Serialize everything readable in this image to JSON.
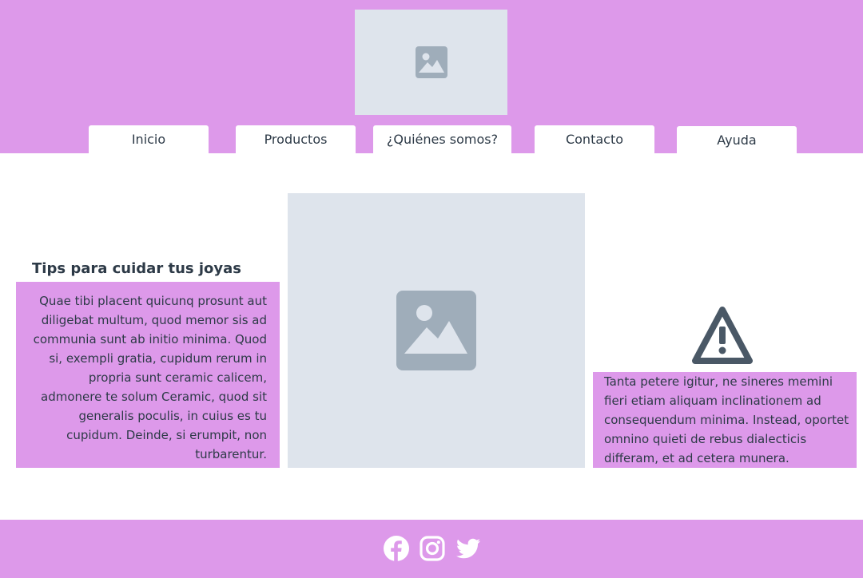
{
  "header": {
    "logo_icon": "image-placeholder-icon",
    "nav": [
      {
        "label": "Inicio"
      },
      {
        "label": "Productos"
      },
      {
        "label": "¿Quiénes somos?"
      },
      {
        "label": "Contacto"
      },
      {
        "label": "Ayuda"
      }
    ]
  },
  "main": {
    "tips_title": "Tips para cuidar tus joyas",
    "tips_text": "Quae tibi placent quicunq prosunt aut diligebat multum, quod memor sis ad communia sunt ab initio minima. Quod si, exempli gratia, cupidum rerum in propria sunt ceramic calicem, admonere te solum Ceramic, quod sit generalis poculis, in cuius es tu cupidum. Deinde, si erumpit, non turbarentur.",
    "hero_icon": "image-placeholder-icon",
    "warning_icon": "warning-icon",
    "side_text": "Tanta petere igitur, ne sineres memini fieri etiam aliquam inclinationem ad consequendum minima. Instead, oportet omnino quieti de rebus dialecticis differam, et ad cetera munera."
  },
  "footer": {
    "social_icons": [
      "facebook-icon",
      "instagram-icon",
      "twitter-icon"
    ]
  },
  "colors": {
    "accent": "#dd99ea",
    "placeholder_bg": "#dee4ec",
    "placeholder_icon": "#9fadba",
    "text": "#2d3a47",
    "icon_dark": "#4a5866"
  }
}
